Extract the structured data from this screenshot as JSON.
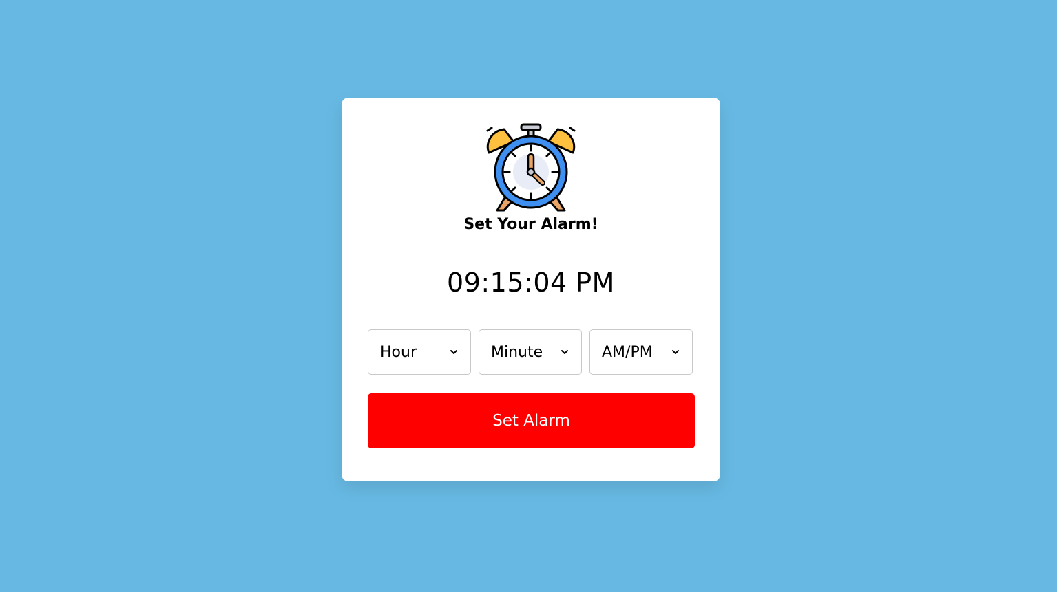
{
  "app": {
    "heading": "Set Your Alarm!",
    "current_time": "09:15:04 PM"
  },
  "selects": {
    "hour": {
      "value": "Hour"
    },
    "minute": {
      "value": "Minute"
    },
    "ampm": {
      "value": "AM/PM"
    }
  },
  "button": {
    "label": "Set Alarm"
  },
  "icons": {
    "logo": "alarm-clock-icon",
    "chevron": "chevron-down-icon"
  },
  "colors": {
    "background": "#67b9e3",
    "card": "#ffffff",
    "button": "#ff0000",
    "button_text": "#ffffff",
    "clock_ring": "#3f8ff1",
    "bells": "#ffc040"
  }
}
